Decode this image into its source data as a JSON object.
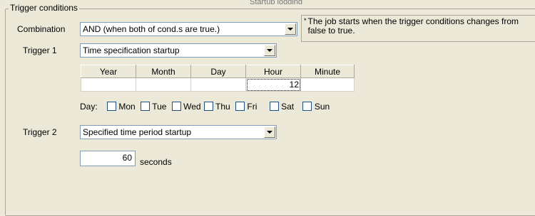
{
  "group": {
    "title": "Trigger conditions"
  },
  "combination": {
    "label": "Combination",
    "value": "AND (when both of cond.s are true.)"
  },
  "note": {
    "marker": "*",
    "text": "The job starts when the trigger conditions changes from false to true."
  },
  "trigger1": {
    "label": "Trigger 1",
    "value": "Time specification startup",
    "columns": [
      "Year",
      "Month",
      "Day",
      "Hour",
      "Minute"
    ],
    "row": [
      "",
      "",
      "",
      "12",
      ""
    ],
    "day_label": "Day:",
    "days": [
      "Mon",
      "Tue",
      "Wed",
      "Thu",
      "Fri",
      "Sat",
      "Sun"
    ]
  },
  "trigger2": {
    "label": "Trigger 2",
    "value": "Specified time period startup"
  },
  "period": {
    "value": "60",
    "unit": "seconds"
  },
  "top_cut_text": "Startup logging"
}
